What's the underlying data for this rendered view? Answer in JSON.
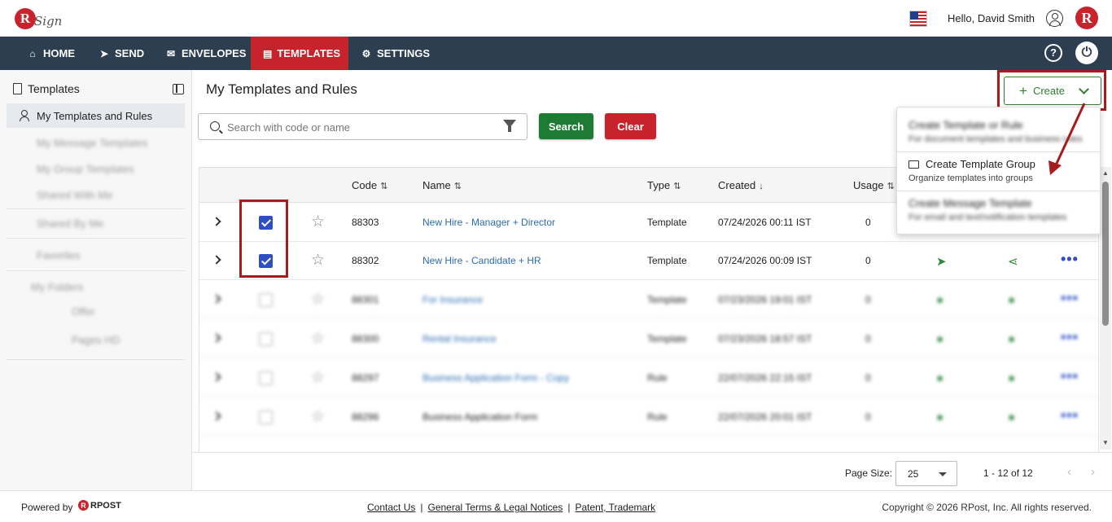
{
  "header": {
    "logo_letter": "R",
    "logo_text": "Sign",
    "greeting": "Hello, David Smith",
    "brand_letter": "R"
  },
  "nav": {
    "items": [
      {
        "label": "HOME",
        "icon": "home-icon"
      },
      {
        "label": "SEND",
        "icon": "paper-plane-icon"
      },
      {
        "label": "ENVELOPES",
        "icon": "envelope-icon"
      },
      {
        "label": "TEMPLATES",
        "icon": "document-icon",
        "active": true
      },
      {
        "label": "SETTINGS",
        "icon": "gear-icon"
      }
    ],
    "help_label": "?",
    "active_color": "#c8232c",
    "bar_color": "#2d3e50"
  },
  "sidebar": {
    "heading": "Templates",
    "items": [
      {
        "label": "My Templates and Rules",
        "active": true
      },
      {
        "label": "My Message Templates"
      },
      {
        "label": "My Group Templates"
      },
      {
        "label": "Shared With Me"
      },
      {
        "label": "Shared By Me"
      },
      {
        "label": "Favorites"
      }
    ],
    "folders_heading": "My Folders",
    "folders": [
      {
        "label": "Offer"
      },
      {
        "label": "Pages HD"
      }
    ]
  },
  "main": {
    "title": "My Templates and Rules",
    "create_label": "Create",
    "search_placeholder": "Search with code or name",
    "search_button": "Search",
    "clear_button": "Clear"
  },
  "table": {
    "columns": [
      "Code",
      "Name",
      "Type",
      "Created",
      "Usage"
    ],
    "rows": [
      {
        "code": "88303",
        "name": "New Hire - Manager + Director",
        "type": "Template",
        "created": "07/24/2026 00:11 IST",
        "usage": "0",
        "checked": true
      },
      {
        "code": "88302",
        "name": "New Hire - Candidate + HR",
        "type": "Template",
        "created": "07/24/2026 00:09 IST",
        "usage": "0",
        "checked": true
      },
      {
        "code": "88301",
        "name": "For Insurance",
        "type": "Template",
        "created": "07/23/2026 19:01 IST",
        "usage": "0",
        "checked": false
      },
      {
        "code": "88300",
        "name": "Rental Insurance",
        "type": "Template",
        "created": "07/23/2026 18:57 IST",
        "usage": "0",
        "checked": false
      },
      {
        "code": "88297",
        "name": "Business Application Form - Copy",
        "type": "Rule",
        "created": "22/07/2026 22:15 IST",
        "usage": "0",
        "checked": false
      },
      {
        "code": "88296",
        "name": "Business Application Form",
        "type": "Rule",
        "created": "22/07/2026 20:01 IST",
        "usage": "0",
        "checked": false
      }
    ]
  },
  "dropdown": {
    "items": [
      {
        "title": "Create Template or Rule",
        "subtitle": "For document templates and business rules"
      },
      {
        "title": "Create Template Group",
        "subtitle": "Organize templates into groups"
      },
      {
        "title": "Create Message Template",
        "subtitle": "For email and text/notification templates"
      }
    ]
  },
  "pager": {
    "page_size_label": "Page Size:",
    "page_size": "25",
    "range": "1 - 12 of 12"
  },
  "footer": {
    "powered_by": "Powered by",
    "rpost_letter": "R",
    "rpost_text": "RPOST",
    "links": [
      "Contact Us",
      "General Terms & Legal Notices",
      "Patent, Trademark"
    ],
    "separator": "|",
    "copyright": "Copyright © 2026 RPost, Inc. All rights reserved."
  }
}
